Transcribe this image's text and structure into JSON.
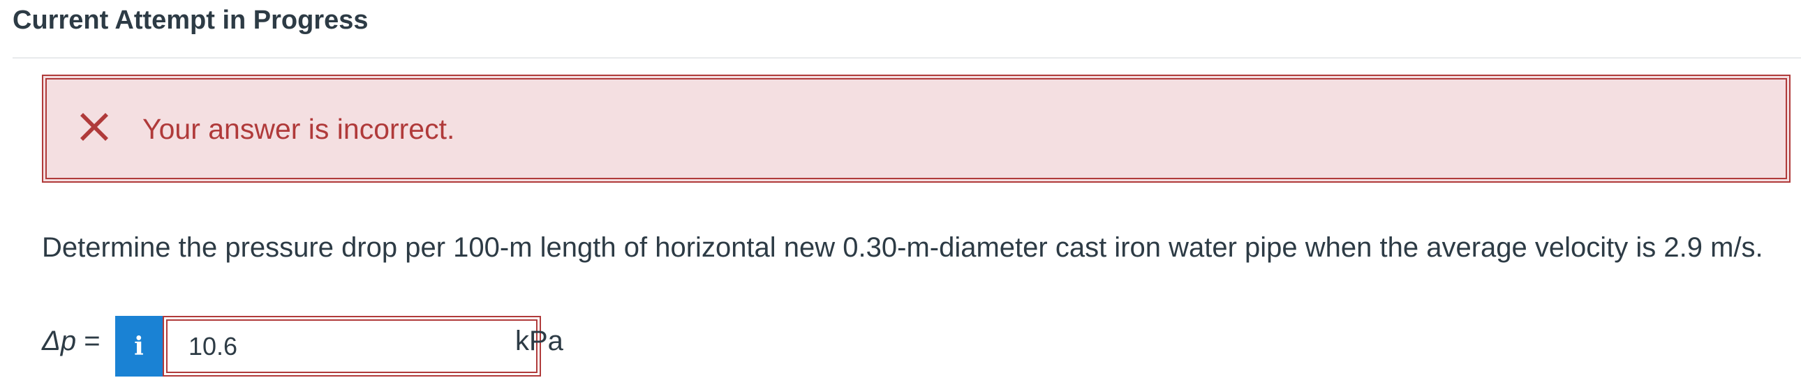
{
  "header": {
    "title": "Current Attempt in Progress"
  },
  "alert": {
    "icon": "close-x-icon",
    "message": "Your answer is incorrect.",
    "color": "#b03a3a",
    "background": "#f4dfe1"
  },
  "question": {
    "text": "Determine the pressure drop per 100-m length of horizontal new 0.30-m-diameter cast iron water pipe when the average velocity is 2.9 m/s."
  },
  "answer": {
    "variable_symbol": "Δp",
    "equals": "=",
    "info_icon": "i",
    "value": "10.6",
    "unit": "kPa",
    "info_button_color": "#1a82d4"
  }
}
